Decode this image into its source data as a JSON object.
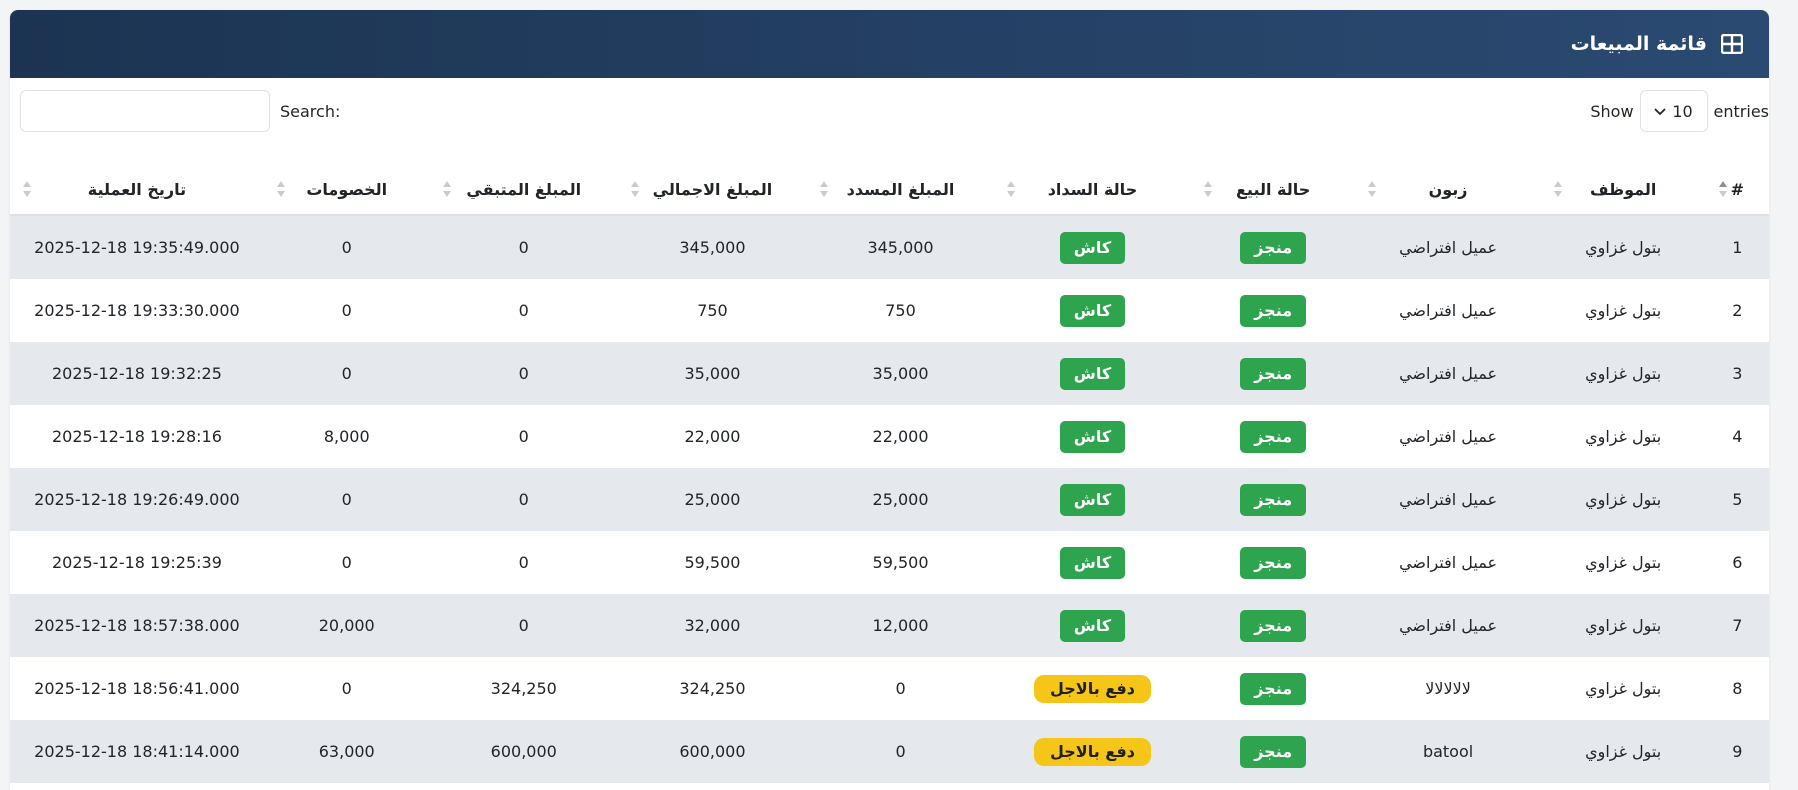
{
  "header": {
    "title": "قائمة المبيعات",
    "icon": "table-icon",
    "bg_color": "#1c3452"
  },
  "toolbar": {
    "search_label": "Search:",
    "search_value": "",
    "show_label": "Show",
    "entries_value": "10",
    "entries_label": "entries"
  },
  "table": {
    "columns": [
      "#",
      "الموظف",
      "زبون",
      "حالة البيع",
      "حالة السداد",
      "المبلغ المسدد",
      "المبلغ الاجمالي",
      "المبلغ المتبقي",
      "الخصومات",
      "تاريخ العملية"
    ],
    "rows": [
      {
        "num": "1",
        "employee": "بتول غزاوي",
        "customer": "عميل افتراضي",
        "sale_status": "منجز",
        "payment_status": "كاش",
        "payment_type": "cash",
        "paid": "345,000",
        "total": "345,000",
        "remaining": "0",
        "discount": "0",
        "date": "2025-12-18 19:35:49.000"
      },
      {
        "num": "2",
        "employee": "بتول غزاوي",
        "customer": "عميل افتراضي",
        "sale_status": "منجز",
        "payment_status": "كاش",
        "payment_type": "cash",
        "paid": "750",
        "total": "750",
        "remaining": "0",
        "discount": "0",
        "date": "2025-12-18 19:33:30.000"
      },
      {
        "num": "3",
        "employee": "بتول غزاوي",
        "customer": "عميل افتراضي",
        "sale_status": "منجز",
        "payment_status": "كاش",
        "payment_type": "cash",
        "paid": "35,000",
        "total": "35,000",
        "remaining": "0",
        "discount": "0",
        "date": "2025-12-18 19:32:25"
      },
      {
        "num": "4",
        "employee": "بتول غزاوي",
        "customer": "عميل افتراضي",
        "sale_status": "منجز",
        "payment_status": "كاش",
        "payment_type": "cash",
        "paid": "22,000",
        "total": "22,000",
        "remaining": "0",
        "discount": "8,000",
        "date": "2025-12-18 19:28:16"
      },
      {
        "num": "5",
        "employee": "بتول غزاوي",
        "customer": "عميل افتراضي",
        "sale_status": "منجز",
        "payment_status": "كاش",
        "payment_type": "cash",
        "paid": "25,000",
        "total": "25,000",
        "remaining": "0",
        "discount": "0",
        "date": "2025-12-18 19:26:49.000"
      },
      {
        "num": "6",
        "employee": "بتول غزاوي",
        "customer": "عميل افتراضي",
        "sale_status": "منجز",
        "payment_status": "كاش",
        "payment_type": "cash",
        "paid": "59,500",
        "total": "59,500",
        "remaining": "0",
        "discount": "0",
        "date": "2025-12-18 19:25:39"
      },
      {
        "num": "7",
        "employee": "بتول غزاوي",
        "customer": "عميل افتراضي",
        "sale_status": "منجز",
        "payment_status": "كاش",
        "payment_type": "cash",
        "paid": "12,000",
        "total": "32,000",
        "remaining": "0",
        "discount": "20,000",
        "date": "2025-12-18 18:57:38.000"
      },
      {
        "num": "8",
        "employee": "بتول غزاوي",
        "customer": "لالالالالا",
        "sale_status": "منجز",
        "payment_status": "دفع بالاجل",
        "payment_type": "deferred",
        "paid": "0",
        "total": "324,250",
        "remaining": "324,250",
        "discount": "0",
        "date": "2025-12-18 18:56:41.000"
      },
      {
        "num": "9",
        "employee": "بتول غزاوي",
        "customer": "batool",
        "sale_status": "منجز",
        "payment_status": "دفع بالاجل",
        "payment_type": "deferred",
        "paid": "0",
        "total": "600,000",
        "remaining": "600,000",
        "discount": "63,000",
        "date": "2025-12-18 18:41:14.000"
      }
    ]
  },
  "colors": {
    "badge_green": "#2ea44f",
    "badge_yellow": "#f5c518",
    "row_stripe": "#e5e8ec"
  }
}
